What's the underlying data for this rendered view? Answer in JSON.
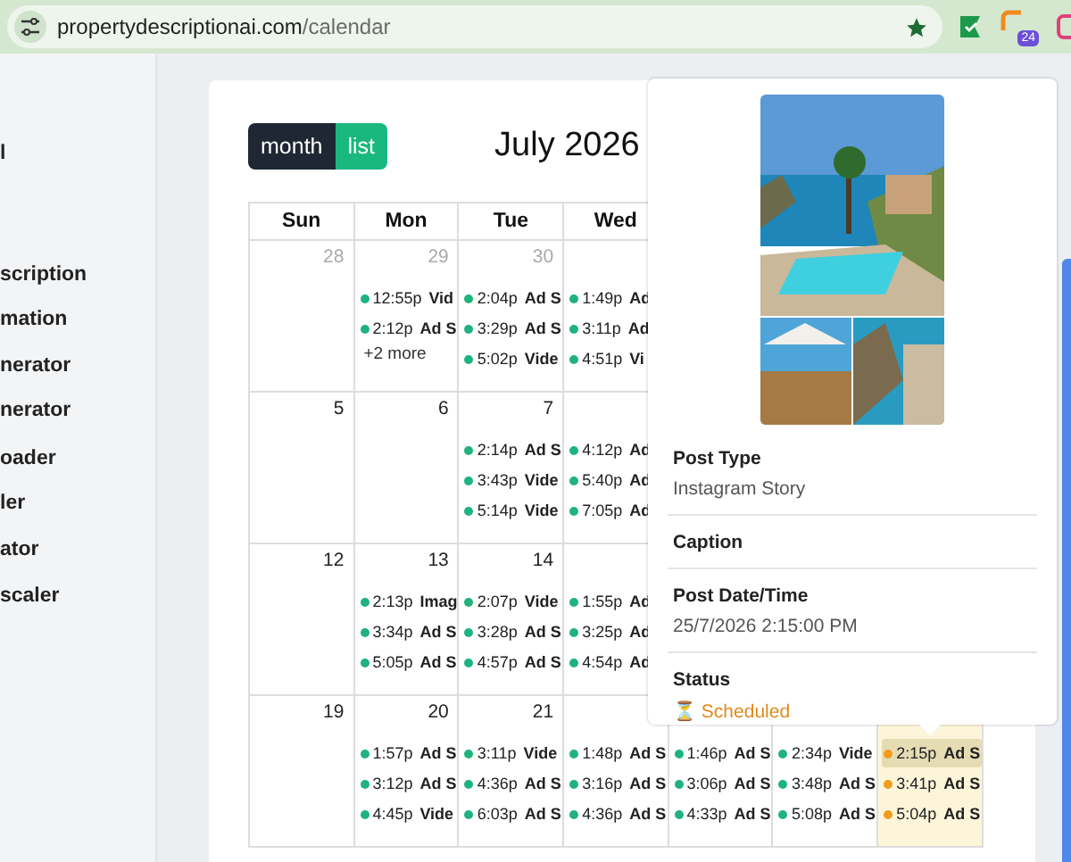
{
  "browser": {
    "url_host": "propertydescriptionai.com",
    "url_path": "/calendar",
    "badge": "24"
  },
  "sidebar": {
    "items": [
      "l",
      "scription",
      "mation",
      "nerator",
      "nerator",
      "oader",
      "ler",
      "ator",
      "scaler"
    ]
  },
  "calendar": {
    "views": [
      {
        "label": "month",
        "selected": true
      },
      {
        "label": "list",
        "selected": false
      }
    ],
    "title": "July 2026",
    "weekdays": [
      "Sun",
      "Mon",
      "Tue",
      "Wed"
    ],
    "weeks": [
      {
        "days": [
          {
            "date": "28",
            "muted": true,
            "today": false
          },
          {
            "date": "29",
            "muted": true,
            "today": false,
            "events": [
              {
                "time": "12:55p",
                "title": "Vid",
                "color": "#1fb37d",
                "selected": false
              },
              {
                "time": "2:12p",
                "title": "Ad S",
                "color": "#1fb37d",
                "selected": false
              }
            ],
            "more": "+2 more"
          },
          {
            "date": "30",
            "muted": true,
            "today": false,
            "events": [
              {
                "time": "2:04p",
                "title": "Ad S",
                "color": "#1fb37d",
                "selected": false
              },
              {
                "time": "3:29p",
                "title": "Ad S",
                "color": "#1fb37d",
                "selected": false
              },
              {
                "time": "5:02p",
                "title": "Vide",
                "color": "#1fb37d",
                "selected": false
              }
            ]
          },
          {
            "today": false,
            "events": [
              {
                "time": "1:49p",
                "title": "Ad",
                "color": "#1fb37d",
                "selected": false
              },
              {
                "time": "3:11p",
                "title": "Ad",
                "color": "#1fb37d",
                "selected": false
              },
              {
                "time": "4:51p",
                "title": "Vi",
                "color": "#1fb37d",
                "selected": false
              }
            ]
          }
        ]
      },
      {
        "days": [
          {
            "date": "5",
            "muted": false,
            "today": false
          },
          {
            "date": "6",
            "muted": false,
            "today": false
          },
          {
            "date": "7",
            "muted": false,
            "today": false,
            "events": [
              {
                "time": "2:14p",
                "title": "Ad S",
                "color": "#1fb37d",
                "selected": false
              },
              {
                "time": "3:43p",
                "title": "Vide",
                "color": "#1fb37d",
                "selected": false
              },
              {
                "time": "5:14p",
                "title": "Vide",
                "color": "#1fb37d",
                "selected": false
              }
            ]
          },
          {
            "today": false,
            "events": [
              {
                "time": "4:12p",
                "title": "Ad",
                "color": "#1fb37d",
                "selected": false
              },
              {
                "time": "5:40p",
                "title": "Ad",
                "color": "#1fb37d",
                "selected": false
              },
              {
                "time": "7:05p",
                "title": "Ad",
                "color": "#1fb37d",
                "selected": false
              }
            ]
          }
        ]
      },
      {
        "days": [
          {
            "date": "12",
            "muted": false,
            "today": false
          },
          {
            "date": "13",
            "muted": false,
            "today": false,
            "events": [
              {
                "time": "2:13p",
                "title": "Imag",
                "color": "#1fb37d",
                "selected": false
              },
              {
                "time": "3:34p",
                "title": "Ad S",
                "color": "#1fb37d",
                "selected": false
              },
              {
                "time": "5:05p",
                "title": "Ad S",
                "color": "#1fb37d",
                "selected": false
              }
            ]
          },
          {
            "date": "14",
            "muted": false,
            "today": false,
            "events": [
              {
                "time": "2:07p",
                "title": "Vide",
                "color": "#1fb37d",
                "selected": false
              },
              {
                "time": "3:28p",
                "title": "Ad S",
                "color": "#1fb37d",
                "selected": false
              },
              {
                "time": "4:57p",
                "title": "Ad S",
                "color": "#1fb37d",
                "selected": false
              }
            ]
          },
          {
            "today": false,
            "events": [
              {
                "time": "1:55p",
                "title": "Ad",
                "color": "#1fb37d",
                "selected": false
              },
              {
                "time": "3:25p",
                "title": "Ad",
                "color": "#1fb37d",
                "selected": false
              },
              {
                "time": "4:54p",
                "title": "Ad",
                "color": "#1fb37d",
                "selected": false
              }
            ]
          }
        ]
      },
      {
        "days": [
          {
            "date": "19",
            "muted": false,
            "today": false
          },
          {
            "date": "20",
            "muted": false,
            "today": false,
            "events": [
              {
                "time": "1:57p",
                "title": "Ad S",
                "color": "#1fb37d",
                "selected": false
              },
              {
                "time": "3:12p",
                "title": "Ad S",
                "color": "#1fb37d",
                "selected": false
              },
              {
                "time": "4:45p",
                "title": "Vide",
                "color": "#1fb37d",
                "selected": false
              }
            ]
          },
          {
            "date": "21",
            "muted": false,
            "today": false,
            "events": [
              {
                "time": "3:11p",
                "title": "Vide",
                "color": "#1fb37d",
                "selected": false
              },
              {
                "time": "4:36p",
                "title": "Ad S",
                "color": "#1fb37d",
                "selected": false
              },
              {
                "time": "6:03p",
                "title": "Ad S",
                "color": "#1fb37d",
                "selected": false
              }
            ]
          },
          {
            "today": false,
            "events": [
              {
                "time": "1:48p",
                "title": "Ad S",
                "color": "#1fb37d",
                "selected": false
              },
              {
                "time": "3:16p",
                "title": "Ad S",
                "color": "#1fb37d",
                "selected": false
              },
              {
                "time": "4:36p",
                "title": "Ad S",
                "color": "#1fb37d",
                "selected": false
              }
            ]
          },
          {
            "today": false,
            "events": [
              {
                "time": "1:46p",
                "title": "Ad S",
                "color": "#1fb37d",
                "selected": false
              },
              {
                "time": "3:06p",
                "title": "Ad S",
                "color": "#1fb37d",
                "selected": false
              },
              {
                "time": "4:33p",
                "title": "Ad S",
                "color": "#1fb37d",
                "selected": false
              }
            ]
          },
          {
            "today": false,
            "events": [
              {
                "time": "2:34p",
                "title": "Vide",
                "color": "#1fb37d",
                "selected": false
              },
              {
                "time": "3:48p",
                "title": "Ad S",
                "color": "#1fb37d",
                "selected": false
              },
              {
                "time": "5:08p",
                "title": "Ad S",
                "color": "#1fb37d",
                "selected": false
              }
            ]
          },
          {
            "today": true,
            "events": [
              {
                "time": "2:15p",
                "title": "Ad S",
                "color": "#f29b1d",
                "selected": true
              },
              {
                "time": "3:41p",
                "title": "Ad S",
                "color": "#f29b1d",
                "selected": false
              },
              {
                "time": "5:04p",
                "title": "Ad S",
                "color": "#f29b1d",
                "selected": false
              }
            ]
          }
        ]
      }
    ]
  },
  "popover": {
    "fields": [
      {
        "label": "Post Type",
        "value": "Instagram Story"
      },
      {
        "label": "Caption"
      },
      {
        "label": "Post Date/Time",
        "value": "25/7/2026 2:15:00 PM"
      },
      {
        "label": "Status",
        "icon": "⏳",
        "value": "Scheduled",
        "kind": "status"
      }
    ]
  }
}
